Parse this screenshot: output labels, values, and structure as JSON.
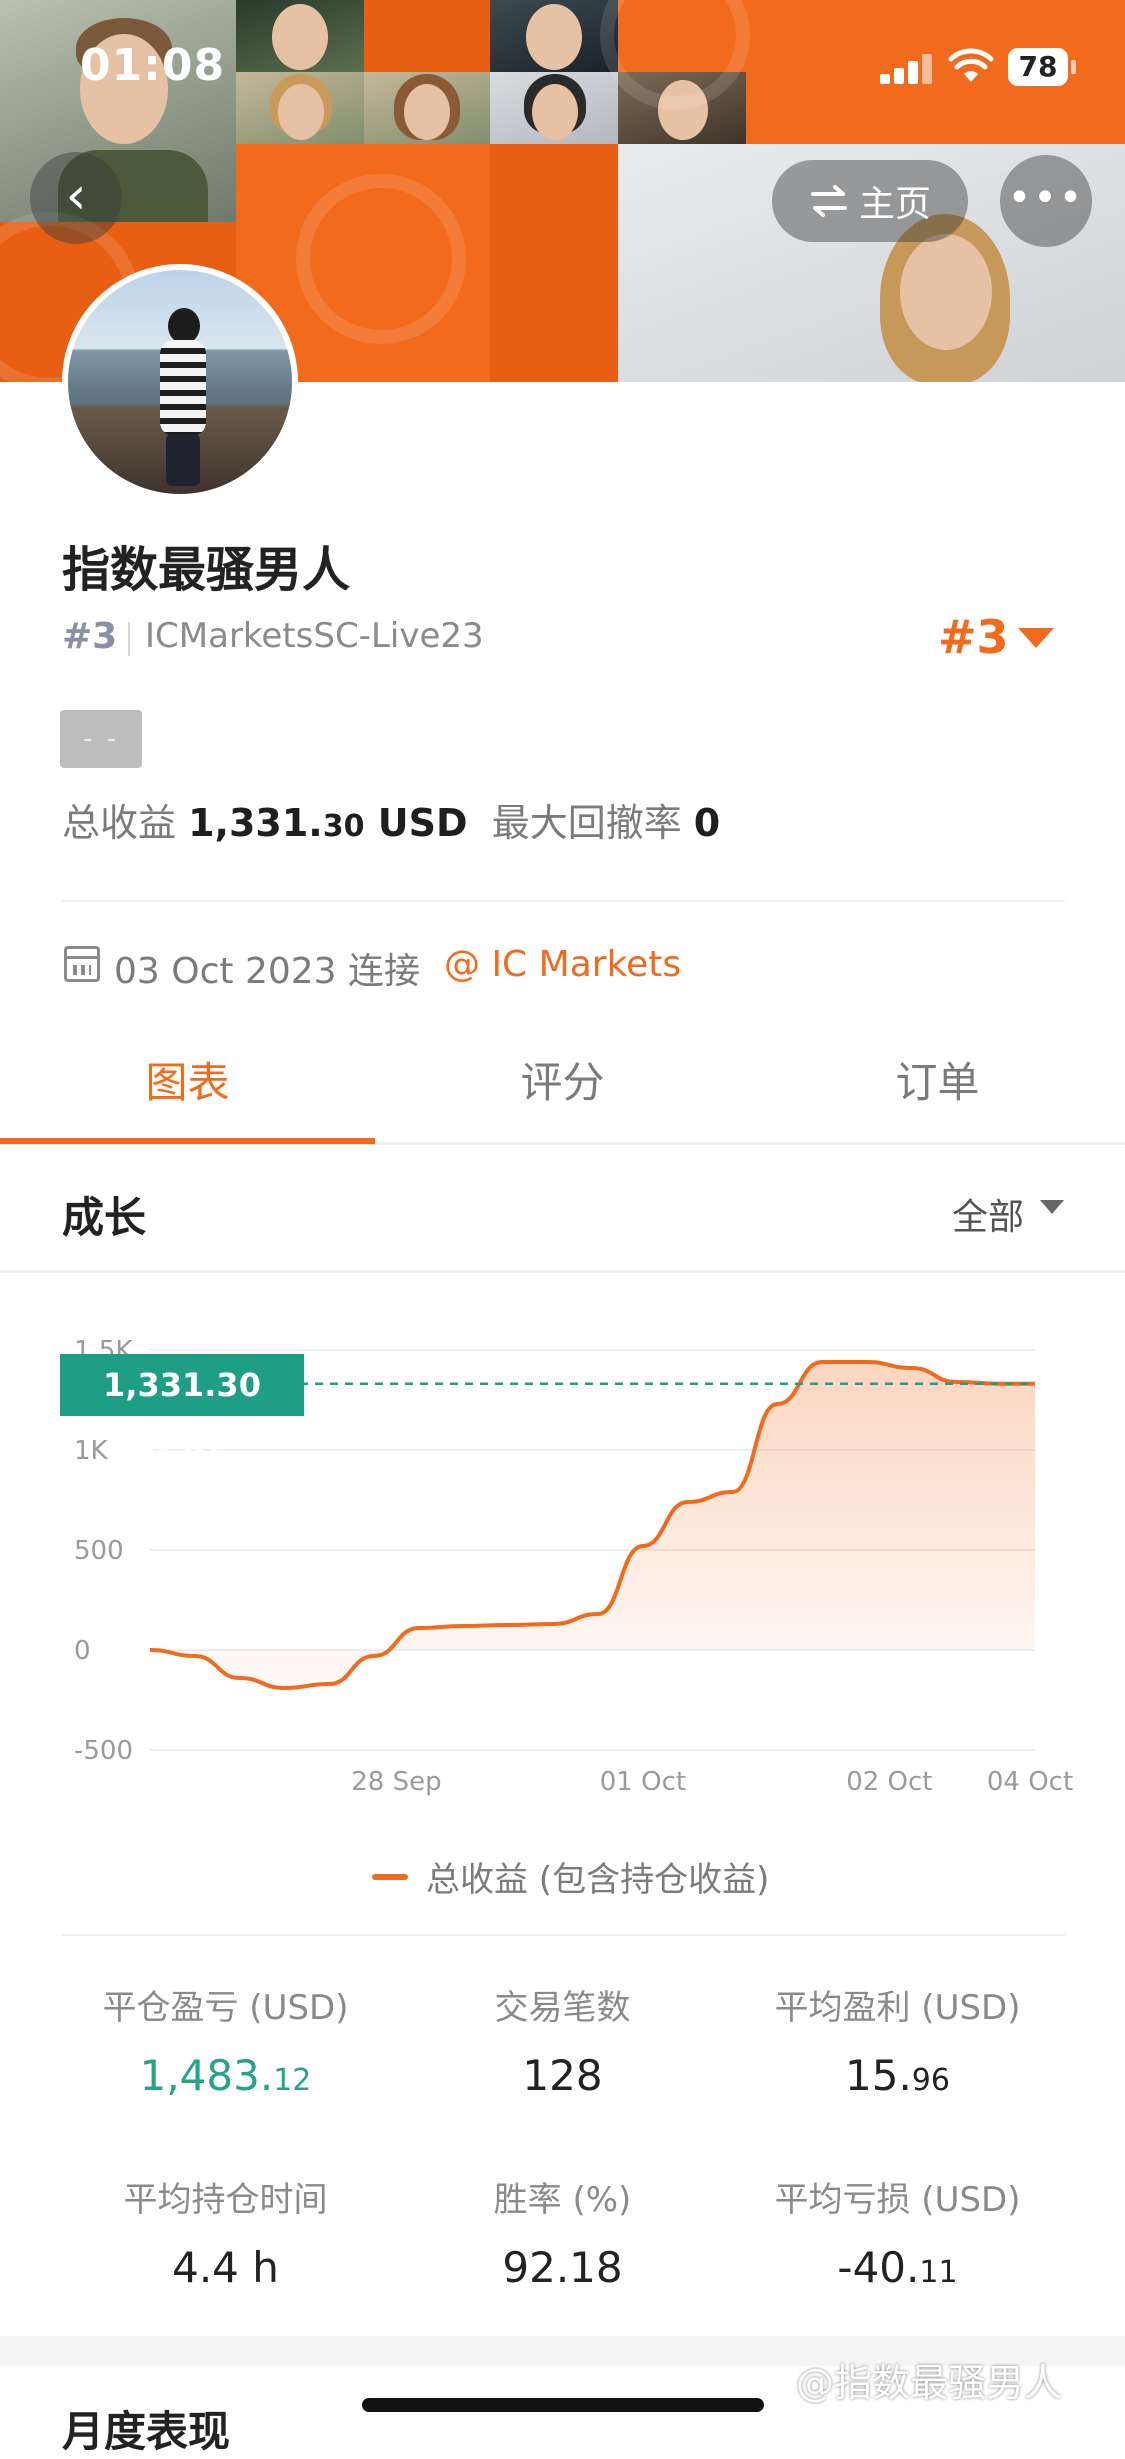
{
  "status_bar": {
    "time": "01:08",
    "battery": "78"
  },
  "header": {
    "home_label": "主页",
    "more_label": "•••",
    "back_label": "‹"
  },
  "profile": {
    "name": "指数最骚男人",
    "rank_small": "#3",
    "account": "ICMarketsSC-Live23",
    "rank_big": "#3",
    "tag": "- -",
    "total_profit_label": "总收益",
    "total_profit_int": "1,331.",
    "total_profit_dec": "30",
    "total_profit_unit": "USD",
    "max_drawdown_label": "最大回撤率",
    "max_drawdown_value": "0",
    "connect_date": "03 Oct 2023 连接",
    "broker": "@ IC Markets"
  },
  "tabs": [
    {
      "label": "图表",
      "active": true
    },
    {
      "label": "评分",
      "active": false
    },
    {
      "label": "订单",
      "active": false
    }
  ],
  "growth": {
    "title": "成长",
    "range": "全部"
  },
  "chart_data": {
    "type": "area",
    "series": [
      {
        "name": "总收益 (包含持仓收益)",
        "color": "#f26b1d",
        "x": [
          0,
          0.4,
          0.8,
          1.2,
          1.6,
          2.0,
          2.4,
          2.8,
          3.2,
          3.6,
          4.0,
          4.4,
          4.8,
          5.2,
          5.6,
          6.0,
          6.4,
          6.8,
          7.2,
          7.6,
          7.9
        ],
        "y": [
          0,
          -30,
          -140,
          -190,
          -170,
          -30,
          110,
          120,
          125,
          130,
          180,
          520,
          740,
          790,
          1230,
          1440,
          1440,
          1410,
          1340,
          1331.3,
          1331.3
        ]
      }
    ],
    "x_ticks": [
      "28 Sep",
      "01 Oct",
      "02 Oct",
      "04 Oct"
    ],
    "y_ticks": [
      "1.5K",
      "1K",
      "500",
      "0",
      "-500"
    ],
    "ylim": [
      -500,
      1500
    ],
    "current_value_label": "1,331.30 USD",
    "legend": "总收益 (包含持仓收益)",
    "grid": true
  },
  "metrics": [
    {
      "label": "平仓盈亏 (USD)",
      "int": "1,483.",
      "dec": "12",
      "green": true
    },
    {
      "label": "交易笔数",
      "int": "128",
      "dec": "",
      "green": false
    },
    {
      "label": "平均盈利 (USD)",
      "int": "15.",
      "dec": "96",
      "green": false
    },
    {
      "label": "平均持仓时间",
      "int": "4.4 h",
      "dec": "",
      "green": false
    },
    {
      "label": "胜率 (%)",
      "int": "92.18",
      "dec": "",
      "green": false
    },
    {
      "label": "平均亏损 (USD)",
      "int": "-40.",
      "dec": "11",
      "green": false
    }
  ],
  "monthly": {
    "title": "月度表现"
  },
  "watermark": "@指数最骚男人",
  "colors": {
    "accent": "#f26b1d",
    "green": "#26a48a",
    "teal_tag": "#1f9e86"
  }
}
